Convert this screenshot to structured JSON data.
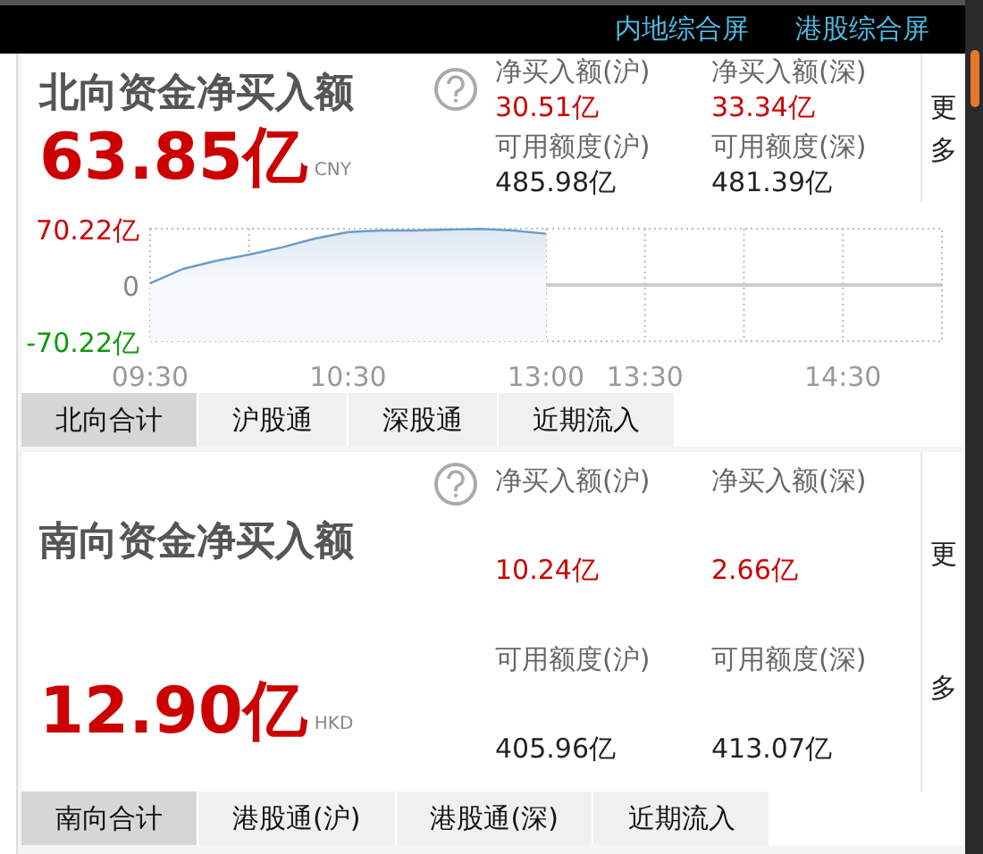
{
  "header": {
    "links": [
      {
        "label": "内地综合屏"
      },
      {
        "label": "港股综合屏"
      }
    ]
  },
  "panels": [
    {
      "title": "北向资金净买入额",
      "amount": "63.85亿",
      "currency": "CNY",
      "more": "更多",
      "stats": [
        {
          "label": "净买入额(沪)",
          "value": "30.51亿",
          "kind": "net"
        },
        {
          "label": "净买入额(深)",
          "value": "33.34亿",
          "kind": "net"
        },
        {
          "label": "可用额度(沪)",
          "value": "485.98亿",
          "kind": "quota"
        },
        {
          "label": "可用额度(深)",
          "value": "481.39亿",
          "kind": "quota"
        }
      ],
      "chart_data": {
        "type": "area",
        "categories": [
          "09:30",
          null,
          null,
          null,
          null,
          null,
          "10:30",
          null,
          null,
          null,
          null,
          null,
          "13:00",
          null,
          null,
          "13:30",
          null,
          null,
          null,
          null,
          null,
          "14:30",
          null,
          null,
          null
        ],
        "series": [
          {
            "color": "#6a9ccc",
            "values": [
              2,
              20,
              30,
              38,
              47,
              58,
              66,
              68,
              68,
              69,
              70,
              68,
              64,
              null,
              null,
              null,
              null,
              null,
              null,
              null,
              null,
              null,
              null,
              null,
              null
            ]
          }
        ],
        "ylim": [
          -70.22,
          70.22
        ],
        "grid": true,
        "yticks": [
          {
            "value": 70.22,
            "label": "70.22亿"
          },
          {
            "value": 0,
            "label": "0"
          },
          {
            "value": -70.22,
            "label": "-70.22亿"
          }
        ]
      },
      "tabs": [
        {
          "label": "北向合计",
          "selected": true
        },
        {
          "label": "沪股通",
          "selected": false
        },
        {
          "label": "深股通",
          "selected": false
        },
        {
          "label": "近期流入",
          "selected": false
        }
      ]
    },
    {
      "title": "南向资金净买入额",
      "amount": "12.90亿",
      "currency": "HKD",
      "more": "更多",
      "stats": [
        {
          "label": "净买入额(沪)",
          "value": "10.24亿",
          "kind": "net"
        },
        {
          "label": "净买入额(深)",
          "value": "2.66亿",
          "kind": "net"
        },
        {
          "label": "可用额度(沪)",
          "value": "405.96亿",
          "kind": "quota"
        },
        {
          "label": "可用额度(深)",
          "value": "413.07亿",
          "kind": "quota"
        }
      ],
      "tabs": [
        {
          "label": "南向合计",
          "selected": true
        },
        {
          "label": "港股通(沪)",
          "selected": false
        },
        {
          "label": "港股通(深)",
          "selected": false
        },
        {
          "label": "近期流入",
          "selected": false
        }
      ]
    }
  ]
}
